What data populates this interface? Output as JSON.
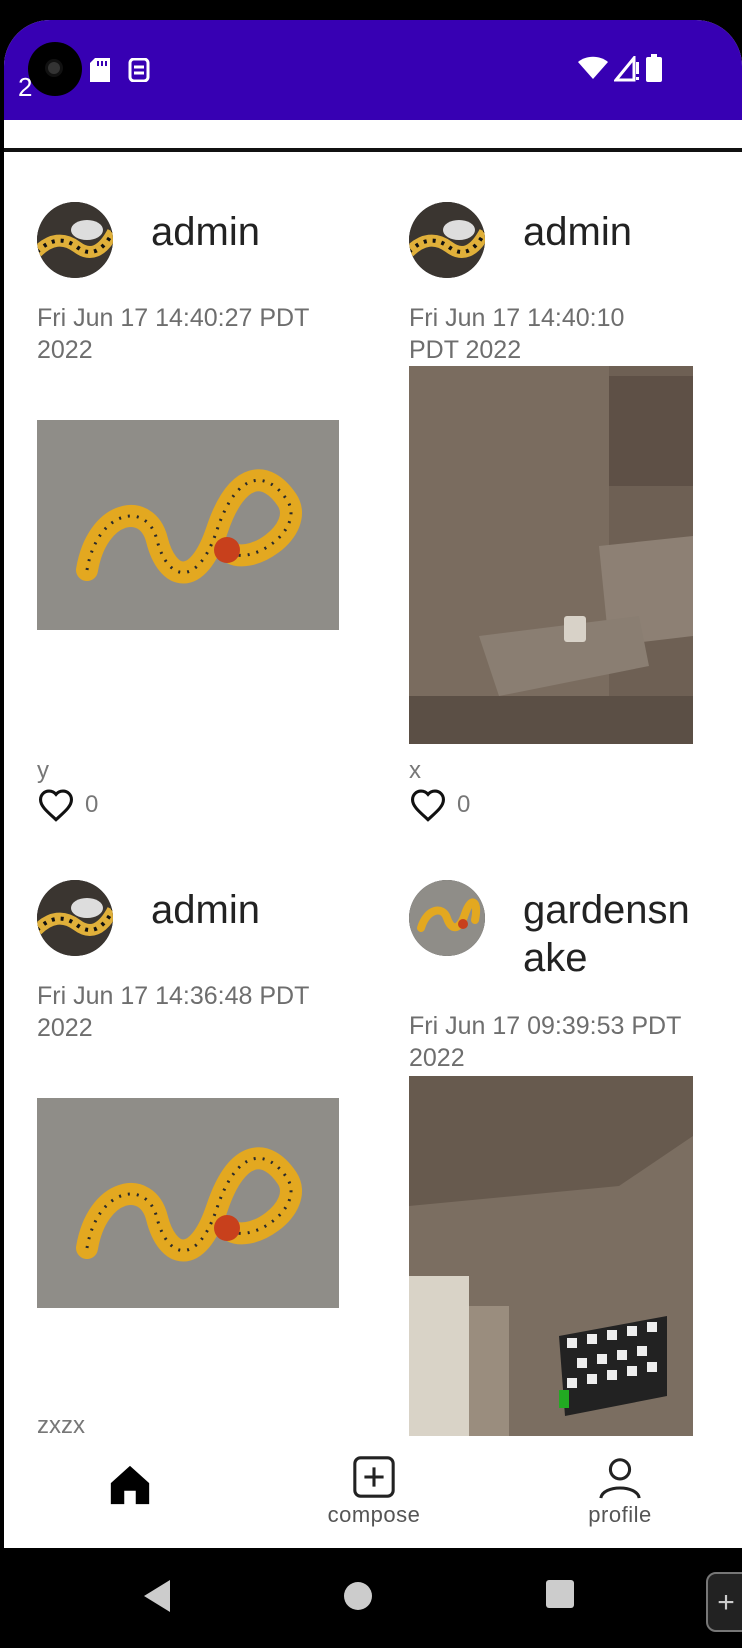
{
  "status_bar": {
    "time": "2",
    "bg_color": "#3700b3"
  },
  "posts": [
    {
      "username": "admin",
      "timestamp": "Fri Jun 17 14:40:27 PDT 2022",
      "caption": "y",
      "likes": "0",
      "image": "snake-photo"
    },
    {
      "username": "admin",
      "timestamp": "Fri Jun 17 14:40:10 PDT 2022",
      "caption": "x",
      "likes": "0",
      "image": "room-photo"
    },
    {
      "username": "admin",
      "timestamp": "Fri Jun 17 14:36:48 PDT 2022",
      "caption": "zxzx",
      "image": "snake-photo"
    },
    {
      "username": "gardensnake",
      "timestamp": "Fri Jun 17 09:39:53 PDT 2022",
      "image": "room-tv-photo"
    }
  ],
  "bottom_nav": {
    "home": {
      "icon": "home-icon"
    },
    "compose": {
      "label": "compose",
      "icon": "add-box-icon"
    },
    "profile": {
      "label": "profile",
      "icon": "person-icon"
    }
  }
}
